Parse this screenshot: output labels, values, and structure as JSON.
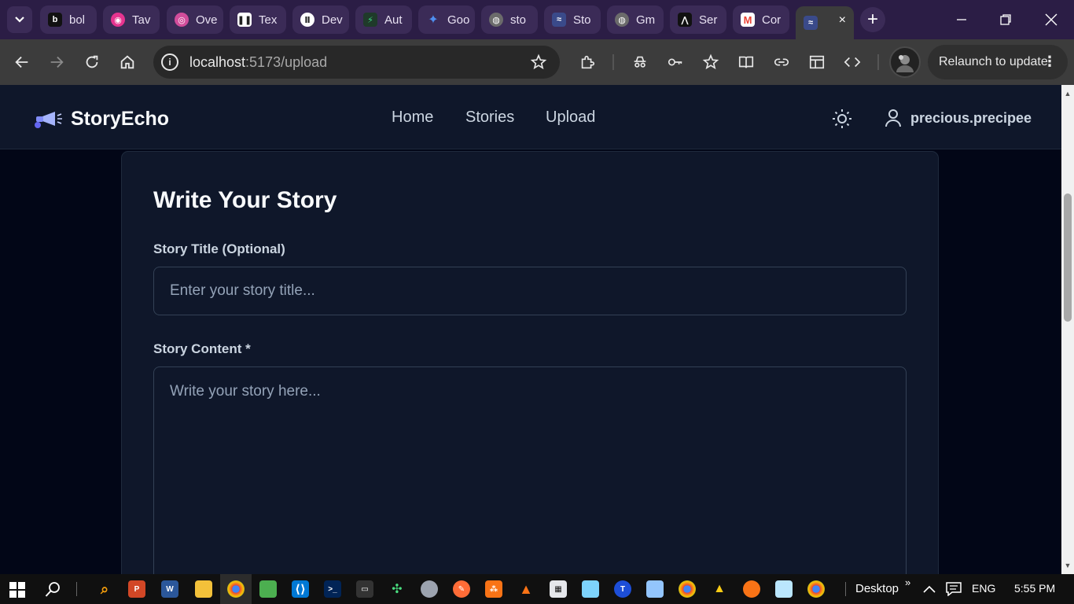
{
  "browser": {
    "tabs": [
      {
        "label": "bol",
        "color": "#111111",
        "glyph": "b"
      },
      {
        "label": "Tav",
        "color": "#e5348f",
        "glyph": "◉"
      },
      {
        "label": "Ove",
        "color": "#d14d9b",
        "glyph": "◎"
      },
      {
        "label": "Tex",
        "color": "#ffffff",
        "glyph": "❚❚"
      },
      {
        "label": "Dev",
        "color": "#ffffff",
        "glyph": "Ⅱ"
      },
      {
        "label": "Aut",
        "color": "#1f8a5a",
        "glyph": "⚡"
      },
      {
        "label": "Goo",
        "color": "#4f7bf0",
        "glyph": "✦"
      },
      {
        "label": "sto",
        "color": "#6b6b6b",
        "glyph": "◍"
      },
      {
        "label": "Sto",
        "color": "#3a4a8a",
        "glyph": "≈"
      },
      {
        "label": "Gm",
        "color": "#6b6b6b",
        "glyph": "◍"
      },
      {
        "label": "Ser",
        "color": "#111111",
        "glyph": "⋀"
      },
      {
        "label": "Cor",
        "color": "#ea4335",
        "glyph": "M"
      }
    ],
    "active_tab_close": "×",
    "new_tab": "+",
    "url_host": "localhost",
    "url_rest": ":5173/upload",
    "relaunch_label": "Relaunch to update",
    "menu_dots": "⋮"
  },
  "site": {
    "brand": "StoryEcho",
    "nav": [
      "Home",
      "Stories",
      "Upload"
    ],
    "username": "precious.precipee"
  },
  "form": {
    "heading": "Write Your Story",
    "title_label": "Story Title (Optional)",
    "title_placeholder": "Enter your story title...",
    "content_label": "Story Content *",
    "content_placeholder": "Write your story here..."
  },
  "taskbar": {
    "desktop_label": "Desktop",
    "chevron": "»",
    "lang": "ENG",
    "time": "5:55 PM"
  },
  "colors": {
    "page_bg": "#020617",
    "card_bg": "#0f172a",
    "tab_strip": "#2b1d45",
    "toolbar": "#3c3c3c"
  }
}
